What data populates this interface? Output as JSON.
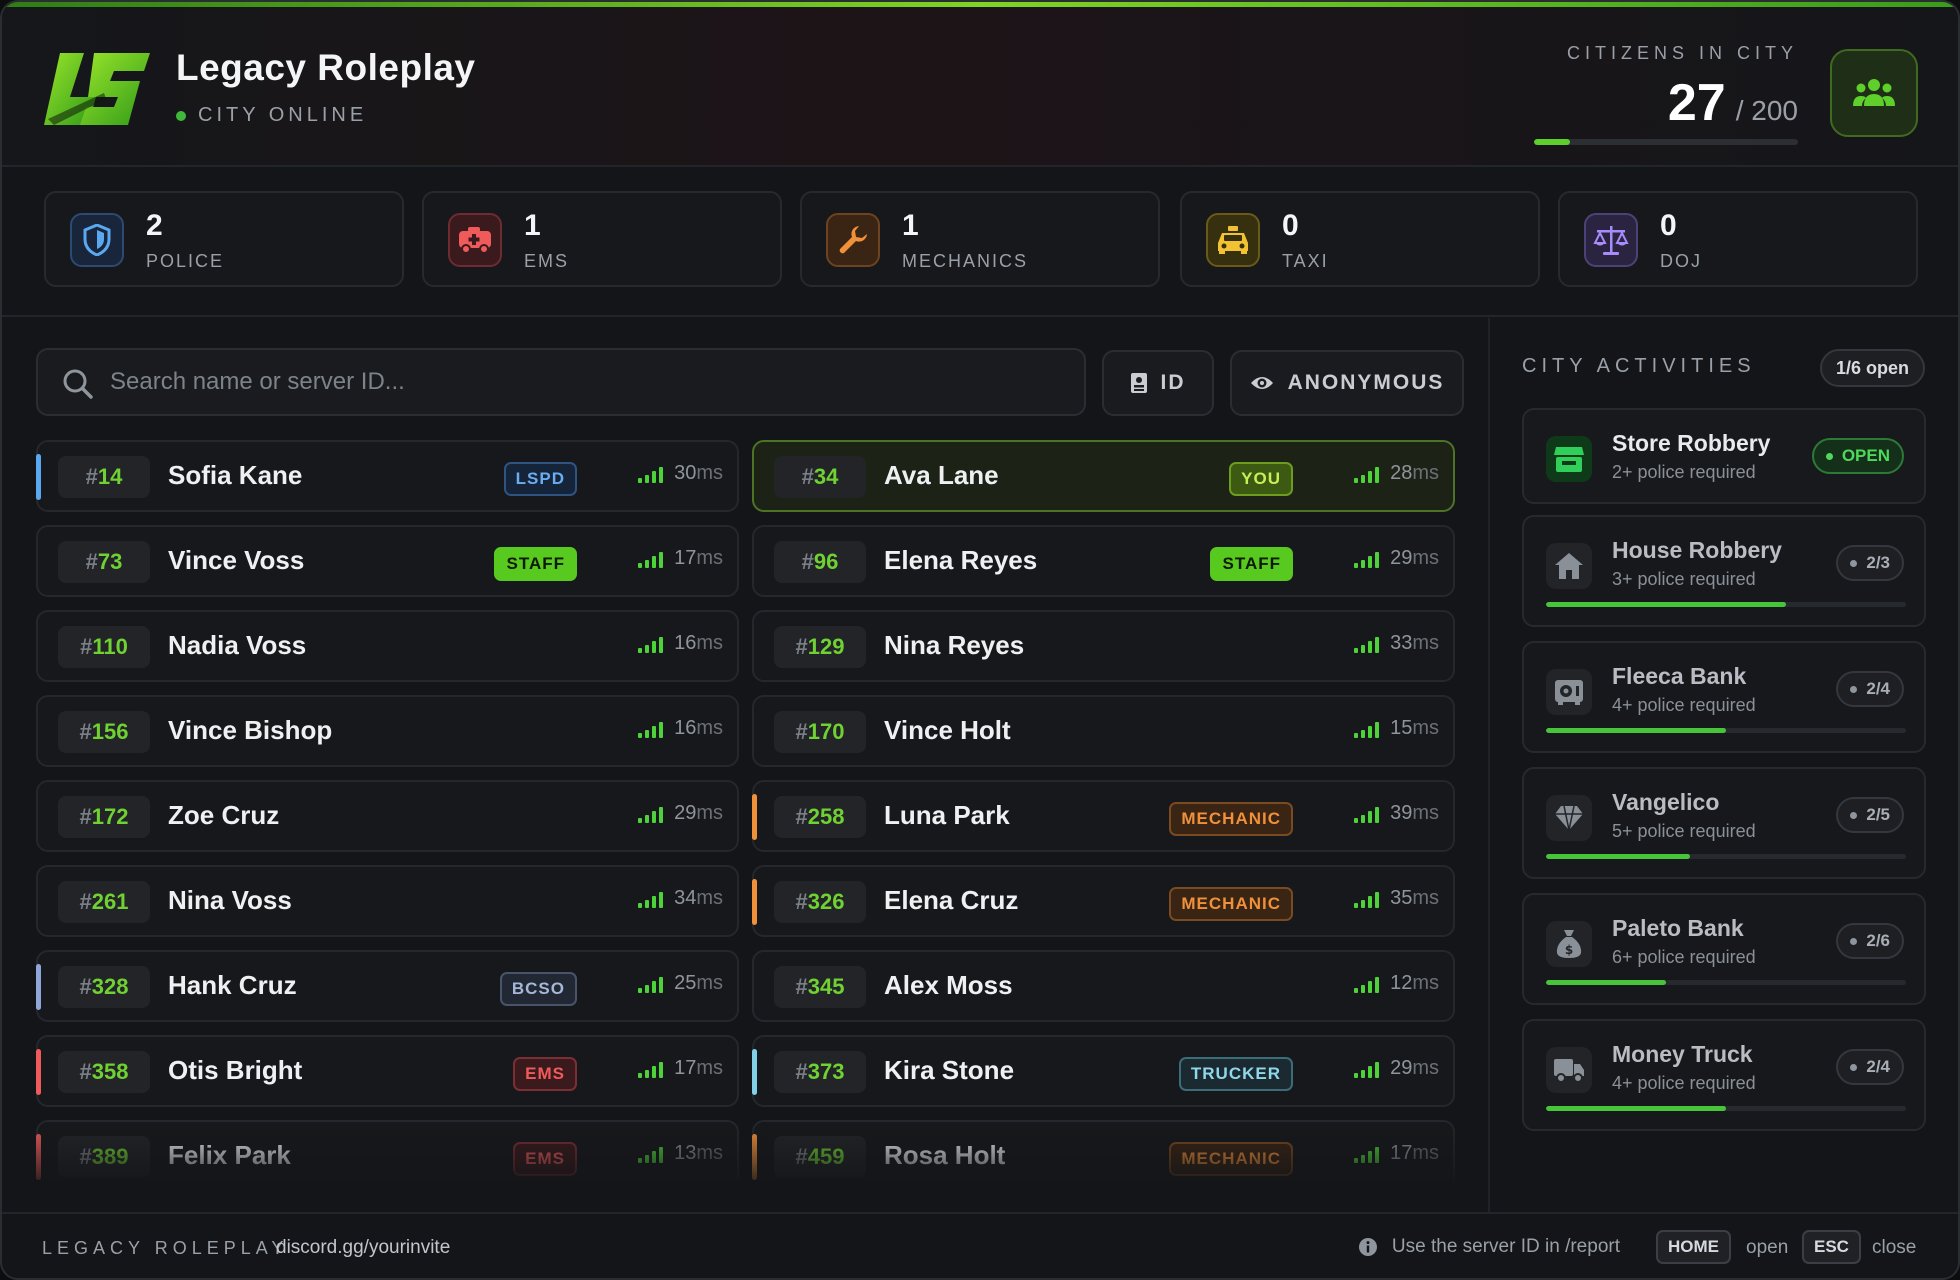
{
  "header": {
    "title": "Legacy Roleplay",
    "status": "CITY ONLINE",
    "citizens_label": "CITIZENS IN CITY",
    "citizens_count": "27",
    "citizens_max": "/ 200",
    "citizens_fraction": 0.135,
    "citizens_icon": "users-icon"
  },
  "stats": [
    {
      "count": "2",
      "label": "POLICE",
      "icon": "shield-icon",
      "color": "#5aa8f0"
    },
    {
      "count": "1",
      "label": "EMS",
      "icon": "ambulance-icon",
      "color": "#ef5b5b"
    },
    {
      "count": "1",
      "label": "MECHANICS",
      "icon": "wrench-icon",
      "color": "#f0913a"
    },
    {
      "count": "0",
      "label": "TAXI",
      "icon": "taxi-icon",
      "color": "#f2c232"
    },
    {
      "count": "0",
      "label": "DOJ",
      "icon": "scales-icon",
      "color": "#a78bfa"
    }
  ],
  "search": {
    "placeholder": "Search name or server ID..."
  },
  "controls": {
    "id_label": "ID",
    "anon_label": "ANONYMOUS"
  },
  "players": [
    {
      "id": "14",
      "name": "Sofia Kane",
      "tag": "LSPD",
      "tag_style": "lspd",
      "ping": "30",
      "accent": "#5aa8f0"
    },
    {
      "id": "34",
      "name": "Ava Lane",
      "tag": "YOU",
      "tag_style": "you",
      "ping": "28",
      "accent": "",
      "you": true
    },
    {
      "id": "73",
      "name": "Vince Voss",
      "tag": "STAFF",
      "tag_style": "staff",
      "ping": "17",
      "accent": ""
    },
    {
      "id": "96",
      "name": "Elena Reyes",
      "tag": "STAFF",
      "tag_style": "staff",
      "ping": "29",
      "accent": ""
    },
    {
      "id": "110",
      "name": "Nadia Voss",
      "tag": "",
      "tag_style": "",
      "ping": "16",
      "accent": ""
    },
    {
      "id": "129",
      "name": "Nina Reyes",
      "tag": "",
      "tag_style": "",
      "ping": "33",
      "accent": ""
    },
    {
      "id": "156",
      "name": "Vince Bishop",
      "tag": "",
      "tag_style": "",
      "ping": "16",
      "accent": ""
    },
    {
      "id": "170",
      "name": "Vince Holt",
      "tag": "",
      "tag_style": "",
      "ping": "15",
      "accent": ""
    },
    {
      "id": "172",
      "name": "Zoe Cruz",
      "tag": "",
      "tag_style": "",
      "ping": "29",
      "accent": ""
    },
    {
      "id": "258",
      "name": "Luna Park",
      "tag": "MECHANIC",
      "tag_style": "mechanic",
      "ping": "39",
      "accent": "#f0913a"
    },
    {
      "id": "261",
      "name": "Nina Voss",
      "tag": "",
      "tag_style": "",
      "ping": "34",
      "accent": ""
    },
    {
      "id": "326",
      "name": "Elena Cruz",
      "tag": "MECHANIC",
      "tag_style": "mechanic",
      "ping": "35",
      "accent": "#f0913a"
    },
    {
      "id": "328",
      "name": "Hank Cruz",
      "tag": "BCSO",
      "tag_style": "bcso",
      "ping": "25",
      "accent": "#8fa6d8"
    },
    {
      "id": "345",
      "name": "Alex Moss",
      "tag": "",
      "tag_style": "",
      "ping": "12",
      "accent": ""
    },
    {
      "id": "358",
      "name": "Otis Bright",
      "tag": "EMS",
      "tag_style": "ems",
      "ping": "17",
      "accent": "#ef5b5b"
    },
    {
      "id": "373",
      "name": "Kira Stone",
      "tag": "TRUCKER",
      "tag_style": "trucker",
      "ping": "29",
      "accent": "#7fd0e8"
    },
    {
      "id": "389",
      "name": "Felix Park",
      "tag": "EMS",
      "tag_style": "ems",
      "ping": "13",
      "accent": "#ef5b5b"
    },
    {
      "id": "459",
      "name": "Rosa Holt",
      "tag": "MECHANIC",
      "tag_style": "mechanic",
      "ping": "17",
      "accent": "#f0913a"
    }
  ],
  "activities": {
    "title": "CITY ACTIVITIES",
    "open_count": "1/6 open",
    "items": [
      {
        "name": "Store Robbery",
        "req": "2+ police required",
        "status": "OPEN",
        "open": true,
        "icon": "store-icon",
        "progress": null
      },
      {
        "name": "House Robbery",
        "req": "3+ police required",
        "status": "2/3",
        "open": false,
        "icon": "house-icon",
        "progress": 0.667
      },
      {
        "name": "Fleeca Bank",
        "req": "4+ police required",
        "status": "2/4",
        "open": false,
        "icon": "vault-icon",
        "progress": 0.5
      },
      {
        "name": "Vangelico",
        "req": "5+ police required",
        "status": "2/5",
        "open": false,
        "icon": "gem-icon",
        "progress": 0.4
      },
      {
        "name": "Paleto Bank",
        "req": "6+ police required",
        "status": "2/6",
        "open": false,
        "icon": "money-bag-icon",
        "progress": 0.333
      },
      {
        "name": "Money Truck",
        "req": "4+ police required",
        "status": "2/4",
        "open": false,
        "icon": "truck-icon",
        "progress": 0.5
      }
    ]
  },
  "footer": {
    "brand": "LEGACY ROLEPLAY",
    "link": "discord.gg/yourinvite",
    "hint": "Use the server ID in /report",
    "key_open": "HOME",
    "key_open_label": "open",
    "key_close": "ESC",
    "key_close_label": "close"
  },
  "ping_unit": "ms",
  "id_prefix": "#"
}
